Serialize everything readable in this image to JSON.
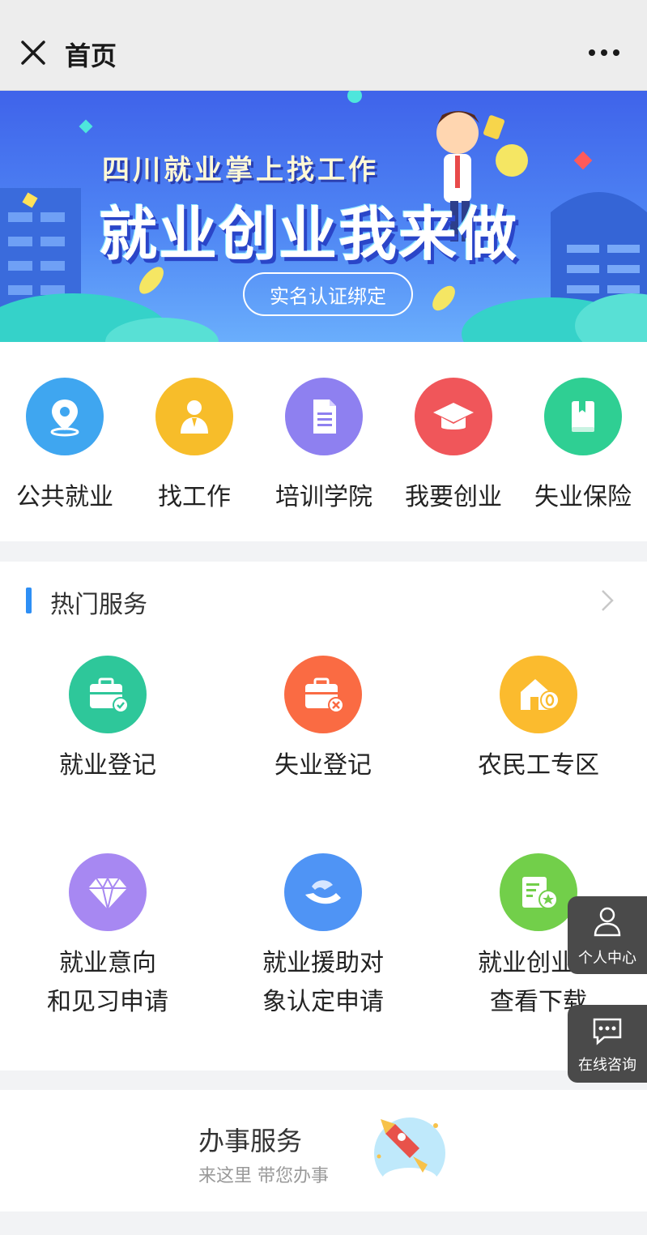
{
  "header": {
    "title": "首页",
    "close_icon": "close-icon",
    "more_icon": "more-dots-icon"
  },
  "banner": {
    "subtitle": "四川就业掌上找工作",
    "title": "就业创业我来做",
    "verify_button": "实名认证绑定"
  },
  "quick_nav": [
    {
      "label": "公共就业",
      "icon": "location-pin-icon",
      "color": "#3fa6f0"
    },
    {
      "label": "找工作",
      "icon": "person-suit-icon",
      "color": "#f7bd2a"
    },
    {
      "label": "培训学院",
      "icon": "document-icon",
      "color": "#8e80f0"
    },
    {
      "label": "我要创业",
      "icon": "graduation-cap-icon",
      "color": "#f0565a"
    },
    {
      "label": "失业保险",
      "icon": "book-icon",
      "color": "#2fcf93"
    }
  ],
  "hot_services": {
    "title": "热门服务",
    "items": [
      {
        "label_lines": [
          "就业登记"
        ],
        "icon": "briefcase-check-icon",
        "color": "#2ec79a"
      },
      {
        "label_lines": [
          "失业登记"
        ],
        "icon": "briefcase-cross-icon",
        "color": "#fa6b43"
      },
      {
        "label_lines": [
          "农民工专区"
        ],
        "icon": "house-coin-icon",
        "color": "#fbbb2e"
      },
      {
        "label_lines": [
          "就业意向",
          "和见习申请"
        ],
        "icon": "diamond-icon",
        "color": "#a788f2"
      },
      {
        "label_lines": [
          "就业援助对",
          "象认定申请"
        ],
        "icon": "helping-hand-icon",
        "color": "#4f94f5"
      },
      {
        "label_lines": [
          "就业创业证",
          "查看下载"
        ],
        "icon": "certificate-star-icon",
        "color": "#72cf4a"
      }
    ]
  },
  "floating": {
    "personal_center": "个人中心",
    "online_consult": "在线咨询"
  },
  "office_service": {
    "title": "办事服务",
    "subtitle": "来这里 带您办事"
  }
}
